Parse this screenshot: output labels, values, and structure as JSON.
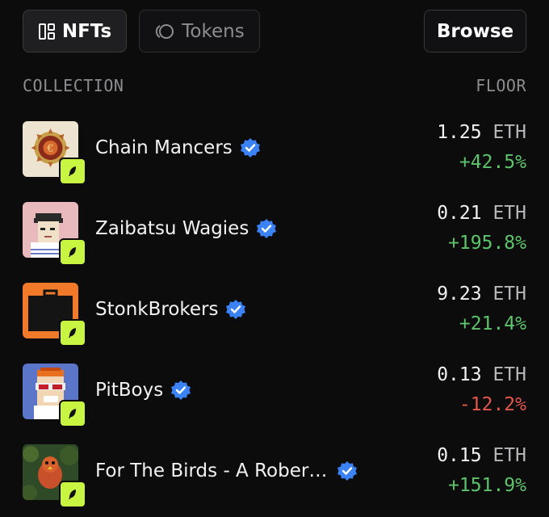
{
  "tabs": {
    "nfts_label": "NFTs",
    "tokens_label": "Tokens",
    "browse_label": "Browse"
  },
  "table": {
    "col_collection": "COLLECTION",
    "col_floor": "FLOOR"
  },
  "collections": [
    {
      "name": "Chain Mancers",
      "price": "1.25",
      "unit": "ETH",
      "change": "+42.5%",
      "direction": "up"
    },
    {
      "name": "Zaibatsu Wagies",
      "price": "0.21",
      "unit": "ETH",
      "change": "+195.8%",
      "direction": "up"
    },
    {
      "name": "StonkBrokers",
      "price": "9.23",
      "unit": "ETH",
      "change": "+21.4%",
      "direction": "up"
    },
    {
      "name": "PitBoys",
      "price": "0.13",
      "unit": "ETH",
      "change": "-12.2%",
      "direction": "down"
    },
    {
      "name": "For The Birds - A Rober…",
      "price": "0.15",
      "unit": "ETH",
      "change": "+151.9%",
      "direction": "up"
    }
  ],
  "colors": {
    "background": "#0c0c0d",
    "positive": "#5dc46b",
    "negative": "#e2574c",
    "verified": "#3b82f6",
    "badge": "#c8f542"
  },
  "icons": {
    "nfts_tab": "grid-icon",
    "tokens_tab": "tokens-icon",
    "verified": "verified-check-icon",
    "badge": "feather-icon"
  }
}
